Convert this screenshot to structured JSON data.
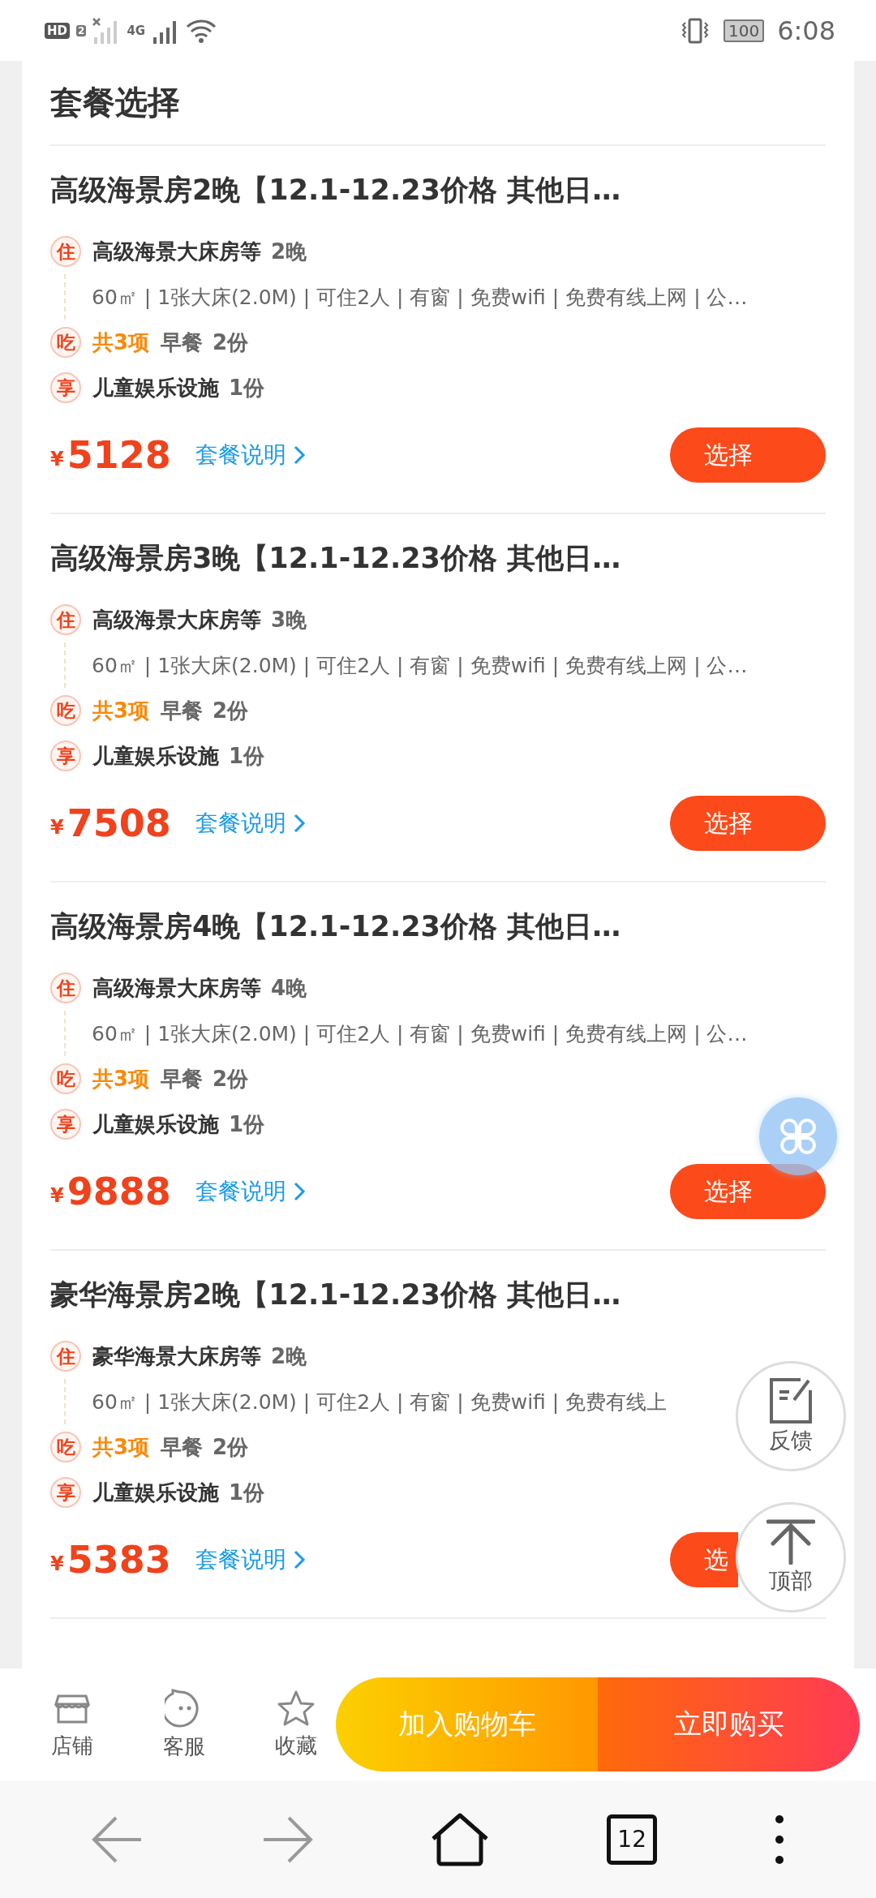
{
  "status_bar": {
    "hd_label": "HD",
    "sim_slot": "2",
    "network": "4G",
    "battery": "100",
    "time": "6:08"
  },
  "section_title": "套餐选择",
  "packages": [
    {
      "title": "高级海景房2晚【12.1-12.23价格 其他日…",
      "items": [
        {
          "kind": "stay",
          "badge": "住",
          "name": "高级海景大床房等",
          "qty": "2晚",
          "details": "60㎡ | 1张大床(2.0M) | 可住2人 | 有窗 | 免费wifi | 免费有线上网 | 公…"
        },
        {
          "kind": "meal",
          "badge": "吃",
          "count": "共3项",
          "name": "早餐",
          "qty": "2份"
        },
        {
          "kind": "perk",
          "badge": "享",
          "name": "儿童娱乐设施",
          "qty": "1份"
        }
      ],
      "currency": "¥",
      "price": "5128",
      "info_link": "套餐说明",
      "button": "选择"
    },
    {
      "title": "高级海景房3晚【12.1-12.23价格 其他日…",
      "items": [
        {
          "kind": "stay",
          "badge": "住",
          "name": "高级海景大床房等",
          "qty": "3晚",
          "details": "60㎡ | 1张大床(2.0M) | 可住2人 | 有窗 | 免费wifi | 免费有线上网 | 公…"
        },
        {
          "kind": "meal",
          "badge": "吃",
          "count": "共3项",
          "name": "早餐",
          "qty": "2份"
        },
        {
          "kind": "perk",
          "badge": "享",
          "name": "儿童娱乐设施",
          "qty": "1份"
        }
      ],
      "currency": "¥",
      "price": "7508",
      "info_link": "套餐说明",
      "button": "选择"
    },
    {
      "title": "高级海景房4晚【12.1-12.23价格 其他日…",
      "items": [
        {
          "kind": "stay",
          "badge": "住",
          "name": "高级海景大床房等",
          "qty": "4晚",
          "details": "60㎡ | 1张大床(2.0M) | 可住2人 | 有窗 | 免费wifi | 免费有线上网 | 公…"
        },
        {
          "kind": "meal",
          "badge": "吃",
          "count": "共3项",
          "name": "早餐",
          "qty": "2份"
        },
        {
          "kind": "perk",
          "badge": "享",
          "name": "儿童娱乐设施",
          "qty": "1份"
        }
      ],
      "currency": "¥",
      "price": "9888",
      "info_link": "套餐说明",
      "button": "选择"
    },
    {
      "title": "豪华海景房2晚【12.1-12.23价格 其他日…",
      "items": [
        {
          "kind": "stay",
          "badge": "住",
          "name": "豪华海景大床房等",
          "qty": "2晚",
          "details": "60㎡ | 1张大床(2.0M) | 可住2人 | 有窗 | 免费wifi | 免费有线上"
        },
        {
          "kind": "meal",
          "badge": "吃",
          "count": "共3项",
          "name": "早餐",
          "qty": "2份"
        },
        {
          "kind": "perk",
          "badge": "享",
          "name": "儿童娱乐设施",
          "qty": "1份"
        }
      ],
      "currency": "¥",
      "price": "5383",
      "info_link": "套餐说明",
      "button": "选"
    }
  ],
  "floating": {
    "feedback": "反馈",
    "to_top": "顶部"
  },
  "action_bar": {
    "shortcuts": [
      {
        "kind": "shop",
        "label": "店铺"
      },
      {
        "kind": "service",
        "label": "客服"
      },
      {
        "kind": "favorite",
        "label": "收藏"
      }
    ],
    "add_to_cart": "加入购物车",
    "buy_now": "立即购买"
  },
  "browser_nav": {
    "tab_count": "12"
  }
}
